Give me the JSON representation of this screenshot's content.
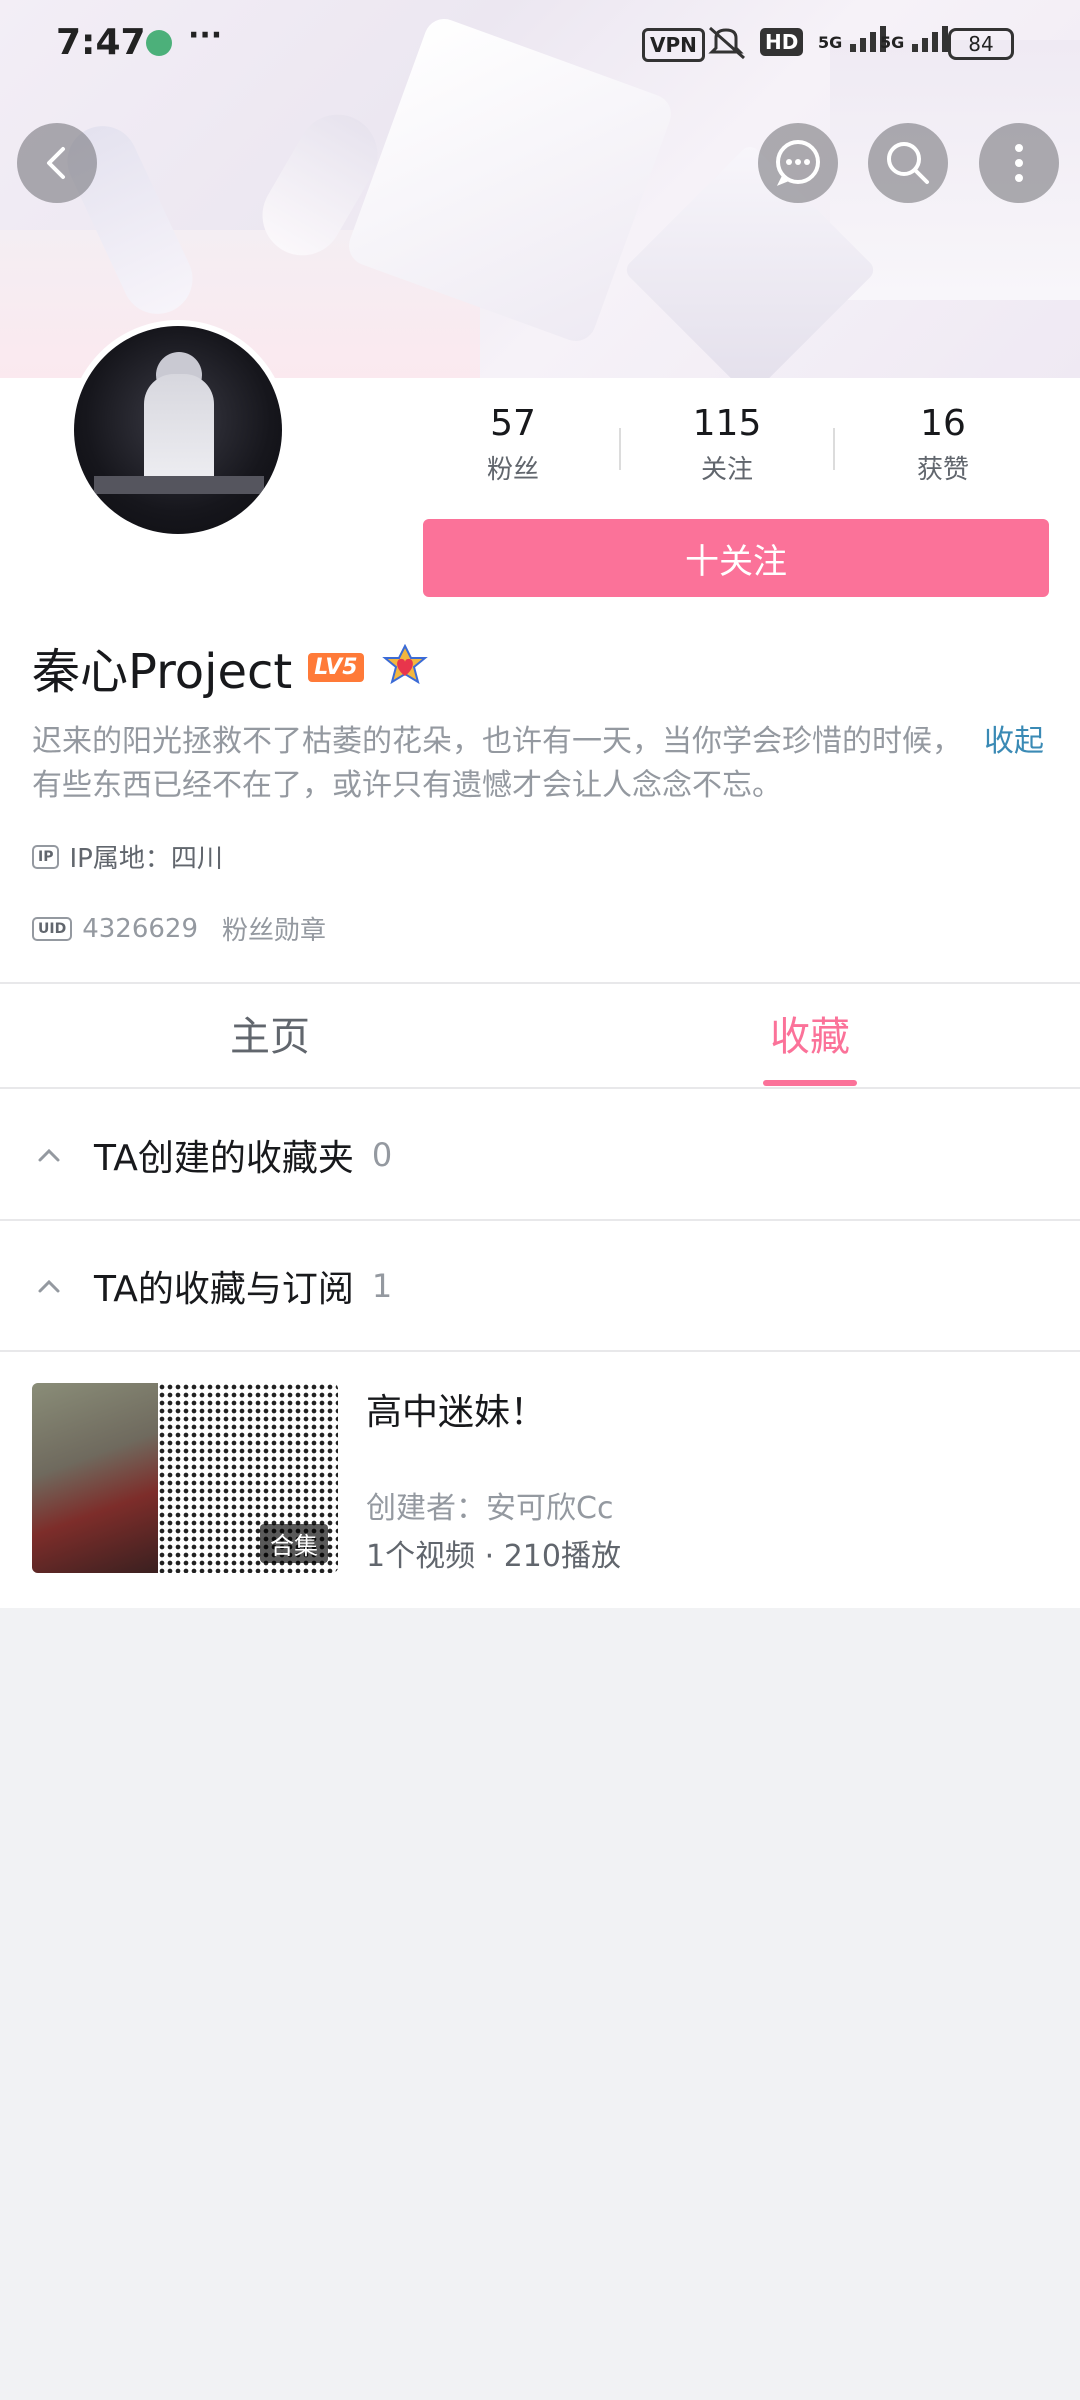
{
  "status_bar": {
    "time": "7:47",
    "more": "···",
    "vpn": "VPN",
    "hd": "HD",
    "signal1": "5G",
    "signal2": "5G",
    "battery": "84"
  },
  "header_icons": [
    "back-icon",
    "chat-icon",
    "search-icon",
    "more-vertical-icon"
  ],
  "stats": [
    {
      "num": "57",
      "label": "粉丝"
    },
    {
      "num": "115",
      "label": "关注"
    },
    {
      "num": "16",
      "label": "获赞"
    }
  ],
  "follow_button": "十关注",
  "profile": {
    "name": "秦心Project",
    "level": "LV5",
    "bio": "迟来的阳光拯救不了枯萎的花朵，也许有一天，当你学会珍惜的时候，有些东西已经不在了，或许只有遗憾才会让人念念不忘。",
    "collapse": "收起",
    "ip_tag": "IP",
    "ip_text": "IP属地：四川",
    "uid_tag": "UID",
    "uid": "4326629",
    "fan_badge": "粉丝勋章"
  },
  "tabs": [
    {
      "label": "主页",
      "active": false
    },
    {
      "label": "收藏",
      "active": true
    }
  ],
  "sections": [
    {
      "title": "TA创建的收藏夹",
      "count": "0"
    },
    {
      "title": "TA的收藏与订阅",
      "count": "1"
    }
  ],
  "favorite_item": {
    "title": "高中迷妹！",
    "badge": "合集",
    "creator": "创建者：安可欣Cc",
    "meta": "1个视频 · 210播放"
  },
  "colors": {
    "accent": "#fb7299",
    "link": "#3a8ab5",
    "level": "#ff7a38"
  }
}
